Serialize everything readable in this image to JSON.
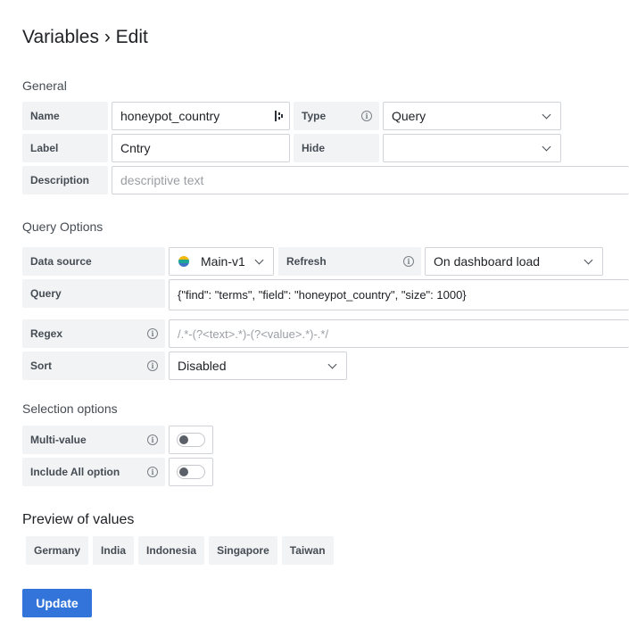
{
  "page": {
    "title": "Variables › Edit"
  },
  "general": {
    "heading": "General",
    "name": {
      "label": "Name",
      "value": "honeypot_country"
    },
    "type": {
      "label": "Type",
      "value": "Query"
    },
    "label": {
      "label": "Label",
      "value": "Cntry"
    },
    "hide": {
      "label": "Hide",
      "value": ""
    },
    "description": {
      "label": "Description",
      "placeholder": "descriptive text"
    }
  },
  "query_options": {
    "heading": "Query Options",
    "data_source": {
      "label": "Data source",
      "value": "Main-v1"
    },
    "refresh": {
      "label": "Refresh",
      "value": "On dashboard load"
    },
    "query": {
      "label": "Query",
      "value": "{\"find\": \"terms\", \"field\": \"honeypot_country\", \"size\": 1000}"
    },
    "regex": {
      "label": "Regex",
      "placeholder": "/.*-(?<text>.*)-(?<value>.*)-.*/"
    },
    "sort": {
      "label": "Sort",
      "value": "Disabled"
    }
  },
  "selection_options": {
    "heading": "Selection options",
    "multi_value": {
      "label": "Multi-value",
      "enabled": false
    },
    "include_all": {
      "label": "Include All option",
      "enabled": false
    }
  },
  "preview": {
    "heading": "Preview of values",
    "values": [
      "Germany",
      "India",
      "Indonesia",
      "Singapore",
      "Taiwan"
    ]
  },
  "actions": {
    "update_label": "Update"
  },
  "icons": {
    "info": "info-circle-icon",
    "chevron": "chevron-down-icon",
    "datasource": "elasticsearch-icon",
    "cursor": "text-cursor-icon"
  },
  "colors": {
    "primary": "#3274d9",
    "label_bg": "#f1f3f5",
    "border": "#d0d3d7"
  }
}
